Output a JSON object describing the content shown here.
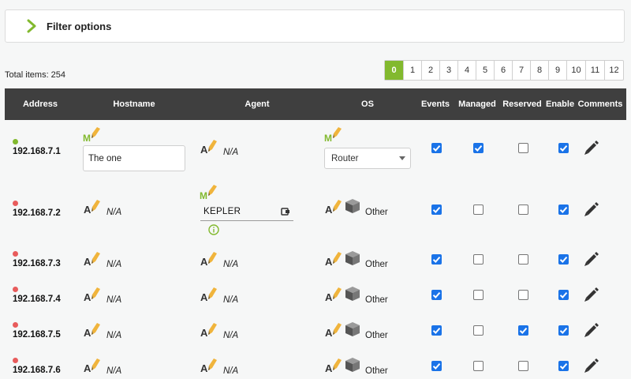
{
  "filter": {
    "title": "Filter options"
  },
  "total": {
    "label": "Total items:",
    "count": "254"
  },
  "pagination": {
    "pages": [
      "0",
      "1",
      "2",
      "3",
      "4",
      "5",
      "6",
      "7",
      "8",
      "9",
      "10",
      "11",
      "12"
    ],
    "active": "0"
  },
  "columns": {
    "address": "Address",
    "hostname": "Hostname",
    "agent": "Agent",
    "os": "OS",
    "events": "Events",
    "managed": "Managed",
    "reserved": "Reserved",
    "enable": "Enable",
    "comments": "Comments"
  },
  "colors": {
    "accent": "#82b92e",
    "header_bg": "#3f3f3f",
    "status_ok": "#82b92e",
    "status_bad": "#e85c5c",
    "checkbox": "#1a73e8",
    "pencil": "#f0b43c"
  },
  "icons": {
    "manual": "M-pencil-icon",
    "auto": "A-pencil-icon",
    "os_other": "cube-icon",
    "edit": "pencil-icon",
    "agent_link": "plug-icon",
    "info": "info-icon",
    "expand": "chevron-right-icon"
  },
  "rows": [
    {
      "address": "192.168.7.1",
      "status": "ok",
      "hostname_value": "The one",
      "agent": "N/A",
      "os_value": "Router",
      "events": true,
      "managed": true,
      "reserved": false,
      "enable": true
    },
    {
      "address": "192.168.7.2",
      "status": "bad",
      "hostname": "N/A",
      "agent_value": "KEPLER",
      "os": "Other",
      "events": true,
      "managed": false,
      "reserved": false,
      "enable": true
    },
    {
      "address": "192.168.7.3",
      "status": "bad",
      "hostname": "N/A",
      "agent": "N/A",
      "os": "Other",
      "events": true,
      "managed": false,
      "reserved": false,
      "enable": true
    },
    {
      "address": "192.168.7.4",
      "status": "bad",
      "hostname": "N/A",
      "agent": "N/A",
      "os": "Other",
      "events": true,
      "managed": false,
      "reserved": false,
      "enable": true
    },
    {
      "address": "192.168.7.5",
      "status": "bad",
      "hostname": "N/A",
      "agent": "N/A",
      "os": "Other",
      "events": true,
      "managed": false,
      "reserved": true,
      "enable": true
    },
    {
      "address": "192.168.7.6",
      "status": "bad",
      "hostname": "N/A",
      "agent": "N/A",
      "os": "Other",
      "events": true,
      "managed": false,
      "reserved": false,
      "enable": true
    }
  ]
}
